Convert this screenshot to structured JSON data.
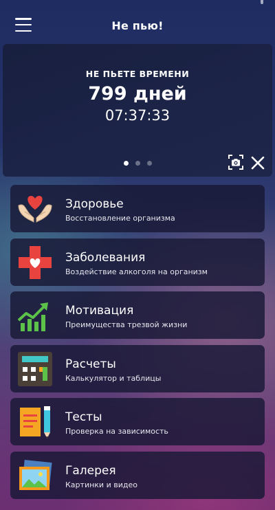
{
  "header": {
    "title": "Не пью!",
    "menu_icon": "hamburger-menu-icon"
  },
  "banner": {
    "label": "НЕ ПЬЕТЕ ВРЕМЕНИ",
    "days": "799 дней",
    "time": "07:37:33",
    "pages": 3,
    "active_page": 1,
    "camera_icon": "screenshot-camera-icon",
    "close_icon": "close-icon"
  },
  "menu": [
    {
      "id": "health",
      "name": "Здоровье",
      "desc": "Восстановление организма",
      "icon": "heart-hands-icon"
    },
    {
      "id": "diseases",
      "name": "Заболевания",
      "desc": "Воздействие алкоголя на организм",
      "icon": "medical-cross-heart-icon"
    },
    {
      "id": "motivation",
      "name": "Мотивация",
      "desc": "Преимущества трезвой жизни",
      "icon": "growth-chart-icon"
    },
    {
      "id": "calculations",
      "name": "Расчеты",
      "desc": "Калькулятор и таблицы",
      "icon": "calculator-icon"
    },
    {
      "id": "tests",
      "name": "Тесты",
      "desc": "Проверка на зависимость",
      "icon": "notepad-pencil-icon"
    },
    {
      "id": "gallery",
      "name": "Галерея",
      "desc": "Картинки и видео",
      "icon": "photo-gallery-icon"
    }
  ],
  "colors": {
    "heart_red": "#e8433f",
    "hands_skin": "#f2d4b3",
    "chart_green": "#5cc24a",
    "calculator_dark": "#4a4038",
    "calculator_screen": "#41c7c8",
    "notepad_orange": "#f5a623",
    "pencil_cyan": "#3fc6e0",
    "gallery_orange": "#f59a1a",
    "gallery_sky": "#8fd4f0"
  }
}
